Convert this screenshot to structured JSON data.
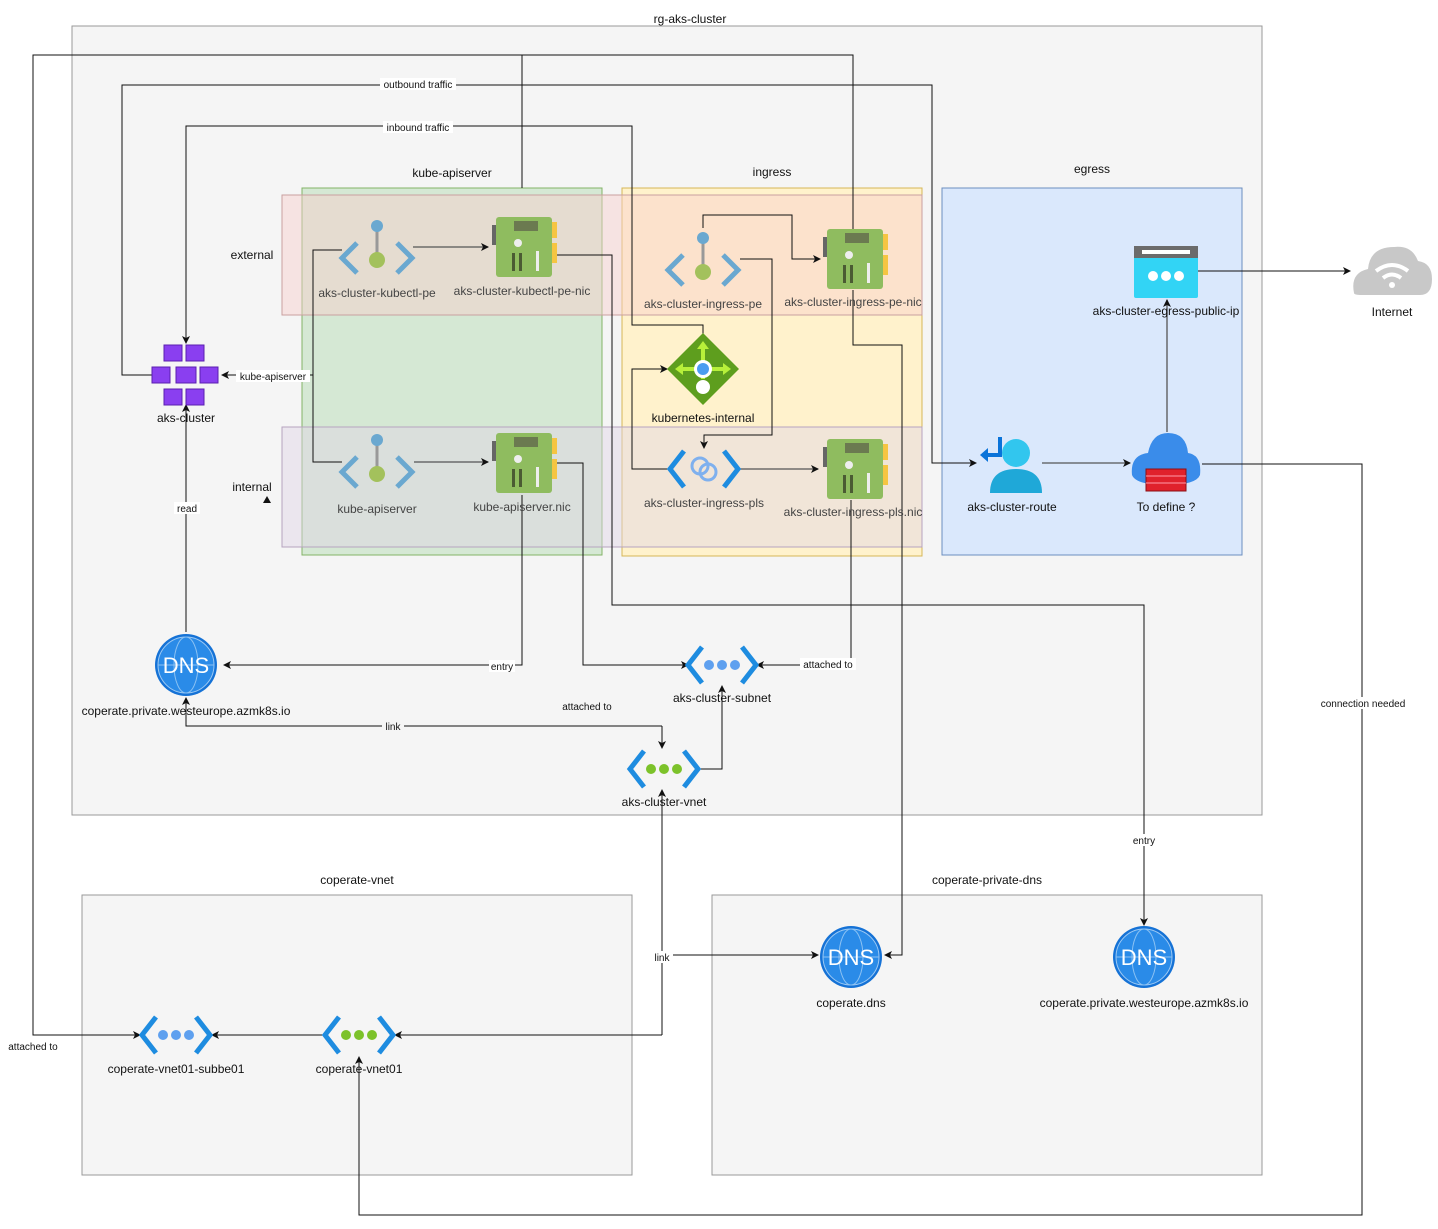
{
  "groups": {
    "rg": "rg-aks-cluster",
    "kube_apiserver": "kube-apiserver",
    "ingress": "ingress",
    "egress": "egress",
    "external": "external",
    "internal": "internal",
    "coperate_vnet": "coperate-vnet",
    "coperate_private_dns": "coperate-private-dns"
  },
  "nodes": {
    "aks_cluster": "aks-cluster",
    "kubectl_pe": "aks-cluster-kubectl-pe",
    "kubectl_pe_nic": "aks-cluster-kubectl-pe-nic",
    "kube_apiserver": "kube-apiserver",
    "kube_apiserver_nic": "kube-apiserver.nic",
    "ingress_pe": "aks-cluster-ingress-pe",
    "ingress_pe_nic": "aks-cluster-ingress-pe-nic",
    "kubernetes_internal": "kubernetes-internal",
    "ingress_pls": "aks-cluster-ingress-pls",
    "ingress_pls_nic": "aks-cluster-ingress-pls.nic",
    "egress_public_ip": "aks-cluster-egress-public-ip",
    "internet": "Internet",
    "route": "aks-cluster-route",
    "firewall": "To define ?",
    "aks_dns": "coperate.private.westeurope.azmk8s.io",
    "subnet": "aks-cluster-subnet",
    "vnet": "aks-cluster-vnet",
    "subbe01": "coperate-vnet01-subbe01",
    "vnet01": "coperate-vnet01",
    "coperate_dns": "coperate.dns",
    "coperate_private_dns_zone": "coperate.private.westeurope.azmk8s.io",
    "dns_glyph": "DNS"
  },
  "edge_labels": {
    "outbound": "outbound traffic",
    "inbound": "inbound traffic",
    "kube_apiserver": "kube-apiserver",
    "read": "read",
    "entry1": "entry",
    "entry2": "entry",
    "attached_subnet": "attached to",
    "attached_to": "attached to",
    "link1": "link",
    "link2": "link",
    "attached_outer": "attached to",
    "connection_needed": "connection needed"
  },
  "colors": {
    "ingress_fill": "#fff2cc",
    "kube_fill": "#d5e8d4",
    "egress_fill": "#dae8fc",
    "external_fill": "#f8cecc",
    "internal_fill": "#e1d5e7",
    "container_fill": "#f5f5f5"
  }
}
